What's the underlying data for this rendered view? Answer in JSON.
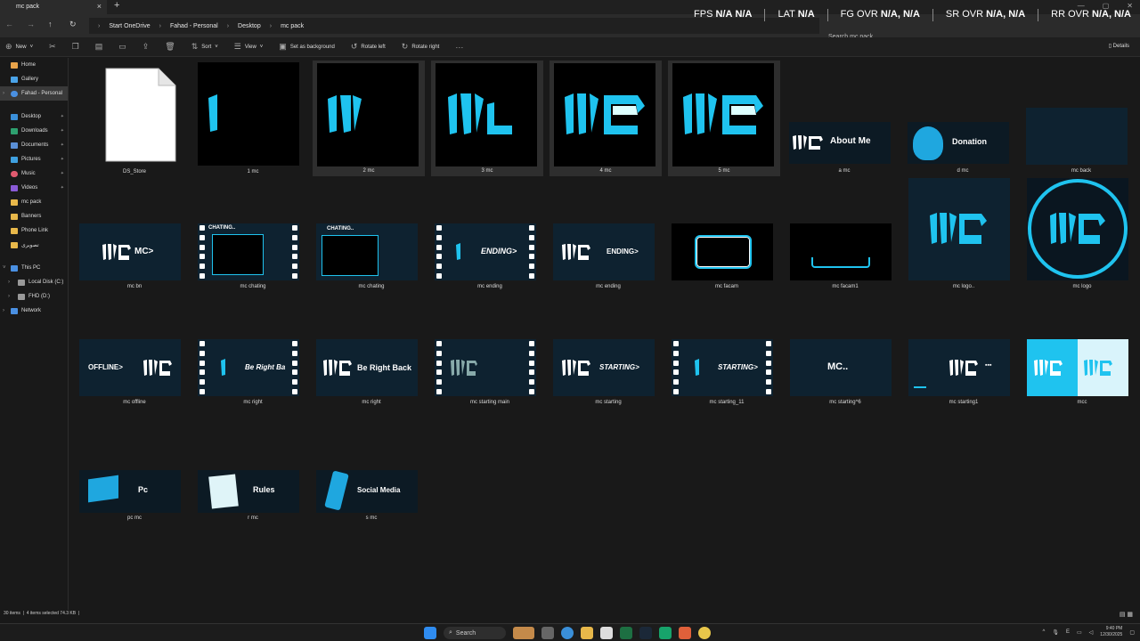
{
  "window": {
    "tab_title": "mc pack",
    "breadcrumbs": [
      "Start OneDrive",
      "Fahad - Personal",
      "Desktop",
      "mc pack"
    ],
    "search_placeholder": "Search mc pack"
  },
  "osd": {
    "fps_label": "FPS",
    "fps_value": "N/A",
    "fps_value2": "N/A",
    "lat_label": "LAT",
    "lat_value": "N/A",
    "fg_label": "FG OVR",
    "fg_value": "N/A, N/A",
    "sr_label": "SR OVR",
    "sr_value": "N/A, N/A",
    "rr_label": "RR OVR",
    "rr_value": "N/A, N/A"
  },
  "toolbar": {
    "new": "New",
    "sort": "Sort",
    "view": "View",
    "set_background": "Set as background",
    "rotate_left": "Rotate left",
    "rotate_right": "Rotate right",
    "details": "Details"
  },
  "sidebar": {
    "items": [
      {
        "label": "Home",
        "color": "#e8a34a"
      },
      {
        "label": "Gallery",
        "color": "#4aa3e8"
      },
      {
        "label": "Fahad - Personal",
        "color": "#4a90e2"
      },
      {
        "label": "Desktop",
        "color": "#3a8fd9"
      },
      {
        "label": "Downloads",
        "color": "#2ea06f"
      },
      {
        "label": "Documents",
        "color": "#5a8fd6"
      },
      {
        "label": "Pictures",
        "color": "#3fa0e0"
      },
      {
        "label": "Music",
        "color": "#e05a6f"
      },
      {
        "label": "Videos",
        "color": "#8a5ad6"
      },
      {
        "label": "mc pack",
        "color": "#e8b84a"
      },
      {
        "label": "Banners",
        "color": "#e8b84a"
      },
      {
        "label": "Phone Link",
        "color": "#e8b84a"
      },
      {
        "label": "تصویری",
        "color": "#e8b84a"
      },
      {
        "label": "This PC",
        "color": "#4a90e2"
      },
      {
        "label": "Local Disk (C:)",
        "color": "#999999"
      },
      {
        "label": "FHD (D:)",
        "color": "#999999"
      },
      {
        "label": "Network",
        "color": "#4a90e2"
      }
    ]
  },
  "files": [
    "DS_Store",
    "1 mc",
    "2 mc",
    "3 mc",
    "4 mc",
    "5 mc",
    "a mc",
    "d mc",
    "mc back",
    "mc bn",
    "mc chating",
    "mc chating",
    "mc ending",
    "mc ending",
    "mc facam",
    "mc facam1",
    "mc logo..",
    "mc logo",
    "mc offline",
    "mc right",
    "mc right",
    "mc starting main",
    "mc starting",
    "mc starting_11",
    "mc starting^6",
    "mc starting1",
    "mcc",
    "pc mc",
    "r mc",
    "s mc"
  ],
  "thumb_text": {
    "about_me": "About Me",
    "donation": "Donation",
    "mc_bn": "MC>",
    "chating": "CHATING..",
    "ending": "ENDING>",
    "offline": "OFFLINE>",
    "be_right": "Be Right Ba",
    "be_right_back": "Be Right Back",
    "starting": "STARTING>",
    "mc_dots": "MC..",
    "pc": "Pc",
    "rules": "Rules",
    "social": "Social Media",
    "mc_logo": "IIC",
    "mc_logo_l": "IIL",
    "mc_logo_i": "II",
    "mc_logo_1": "I"
  },
  "status": {
    "count": "30 items",
    "selected": "4 items selected",
    "size": "74.3 KB"
  },
  "taskbar": {
    "search": "Search",
    "time": "9:40 PM",
    "date": "12/30/2025",
    "lang": "E"
  },
  "colors": {
    "accent": "#1fc3ef",
    "folder": "#e8b84a"
  }
}
